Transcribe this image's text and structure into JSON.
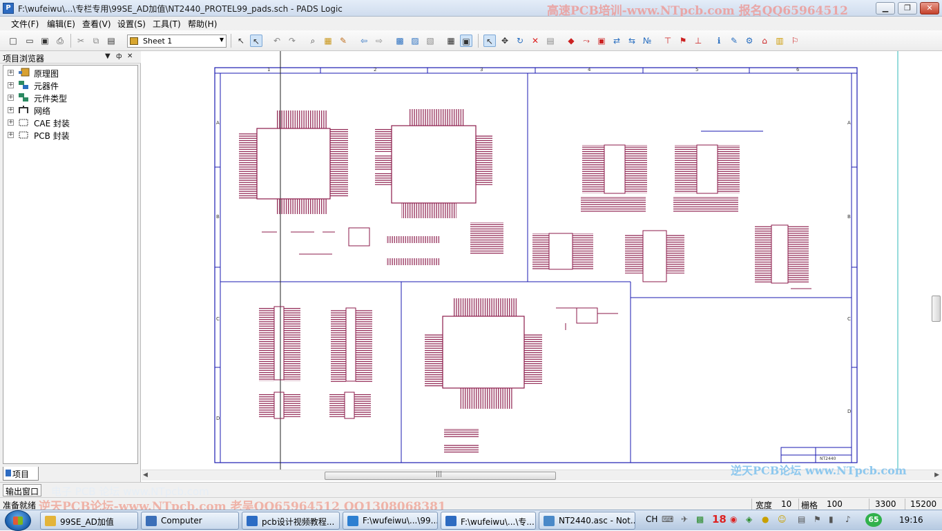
{
  "window": {
    "title": "F:\\wufeiwu\\...\\专栏专用\\99SE_AD加值\\NT2440_PROTEL99_pads.sch - PADS Logic",
    "watermark": "高速PCB培训-www.NTpcb.com  报名QQ65964512",
    "controls": {
      "minimize": "▁",
      "restore": "❐",
      "close": "✕"
    }
  },
  "menu": [
    "文件(F)",
    "编辑(E)",
    "查看(V)",
    "设置(S)",
    "工具(T)",
    "帮助(H)"
  ],
  "toolbar": {
    "sheet_select": "Sheet 1",
    "icons": [
      "new-icon",
      "open-icon",
      "save-icon",
      "print-icon",
      "cut-icon",
      "copy-icon",
      "paste-icon",
      "select-filter-icon",
      "select-mode-icon",
      "undo-icon",
      "redo-icon",
      "zoom-icon",
      "zoom-window-icon",
      "redraw-icon",
      "prev-sheet-icon",
      "next-sheet-icon",
      "pads-layout-icon",
      "pads-router-icon",
      "cam-icon",
      "report-icon",
      "display-icon",
      "select-icon",
      "move-icon",
      "rotate-icon",
      "delete-icon",
      "properties-icon",
      "add-part-icon",
      "add-wire-icon",
      "add-bus-icon",
      "swap-pin-icon",
      "swap-gate-icon",
      "renumber-icon",
      "add-connection-icon",
      "add-net-label-icon",
      "add-power-icon",
      "query-icon",
      "edit-text-icon",
      "edit-part-icon",
      "hierarchy-icon",
      "highlight-icon",
      "flag-icon"
    ]
  },
  "project_panel": {
    "title": "项目浏览器",
    "controls": {
      "menu": "▼",
      "pin": "ф",
      "close": "✕"
    },
    "items": [
      {
        "label": "原理图",
        "icon": "schematic-icon"
      },
      {
        "label": "元器件",
        "icon": "components-icon"
      },
      {
        "label": "元件类型",
        "icon": "part-types-icon"
      },
      {
        "label": "网络",
        "icon": "nets-icon"
      },
      {
        "label": "CAE 封装",
        "icon": "cae-decal-icon"
      },
      {
        "label": "PCB 封装",
        "icon": "pcb-decal-icon"
      }
    ],
    "tab": "项目"
  },
  "schematic": {
    "col_labels": [
      "1",
      "2",
      "3",
      "4",
      "5",
      "6"
    ],
    "row_labels": [
      "A",
      "B",
      "C",
      "D"
    ],
    "title_block_caption": "NT2440"
  },
  "output_window": {
    "tab": "输出窗口",
    "faint_text": "电子 PCB 论坛 www.NTpcb.com"
  },
  "watermark_mid": "逆天PCB论坛  www.NTpcb.com",
  "status": {
    "ready": "准备就绪",
    "watermark": "逆天PCB论坛-www.NTpcb.com  老吴QQ65964512  QQ1308068381",
    "width_label": "宽度",
    "width_value": "10",
    "grid_label": "栅格",
    "grid_value": "100",
    "x": "3300",
    "y": "15200"
  },
  "taskbar": {
    "tasks": [
      {
        "label": "99SE_AD加值",
        "icon_color": "#e3b43a"
      },
      {
        "label": "Computer",
        "icon_color": "#3b6fb8"
      },
      {
        "label": "pcb设计视频教程...",
        "icon_color": "#2c6cc4"
      },
      {
        "label": "F:\\wufeiwu\\...\\99...",
        "icon_color": "#2d7fd1"
      },
      {
        "label": "F:\\wufeiwu\\...\\专...",
        "icon_color": "#2d6bc1"
      },
      {
        "label": "NT2440.asc - Not...",
        "icon_color": "#4a89c8"
      }
    ],
    "lang": "CH",
    "badge_number": "18",
    "tray_badge": "65",
    "time": "19:16"
  }
}
